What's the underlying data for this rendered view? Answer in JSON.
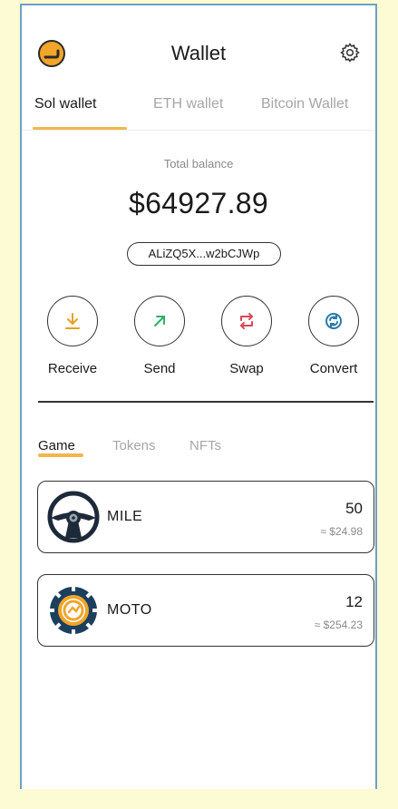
{
  "header": {
    "title": "Wallet",
    "logo_icon": "logo-icon",
    "settings_icon": "gear-icon"
  },
  "wallet_tabs": [
    {
      "label": "Sol wallet",
      "active": true
    },
    {
      "label": "ETH wallet",
      "active": false
    },
    {
      "label": "Bitcoin Wallet",
      "active": false
    }
  ],
  "balance": {
    "label": "Total balance",
    "value": "$64927.89",
    "address": "ALiZQ5X...w2bCJWp"
  },
  "actions": [
    {
      "label": "Receive",
      "icon": "download-icon"
    },
    {
      "label": "Send",
      "icon": "arrow-up-right-icon"
    },
    {
      "label": "Swap",
      "icon": "swap-icon"
    },
    {
      "label": "Convert",
      "icon": "refresh-icon"
    }
  ],
  "asset_tabs": [
    {
      "label": "Game",
      "active": true
    },
    {
      "label": "Tokens",
      "active": false
    },
    {
      "label": "NFTs",
      "active": false
    }
  ],
  "assets": [
    {
      "name": "MILE",
      "amount": "50",
      "usd": "≈ $24.98",
      "icon": "steering-wheel-icon"
    },
    {
      "name": "MOTO",
      "amount": "12",
      "usd": "≈ $254.23",
      "icon": "gear-wheel-icon"
    }
  ],
  "colors": {
    "accent": "#f2b64b",
    "receive": "#e7a01f",
    "send": "#2fae6b",
    "swap": "#d9485a",
    "convert": "#2a7aa8",
    "frame": "#6f9fc3",
    "background": "#fdfbd4"
  }
}
